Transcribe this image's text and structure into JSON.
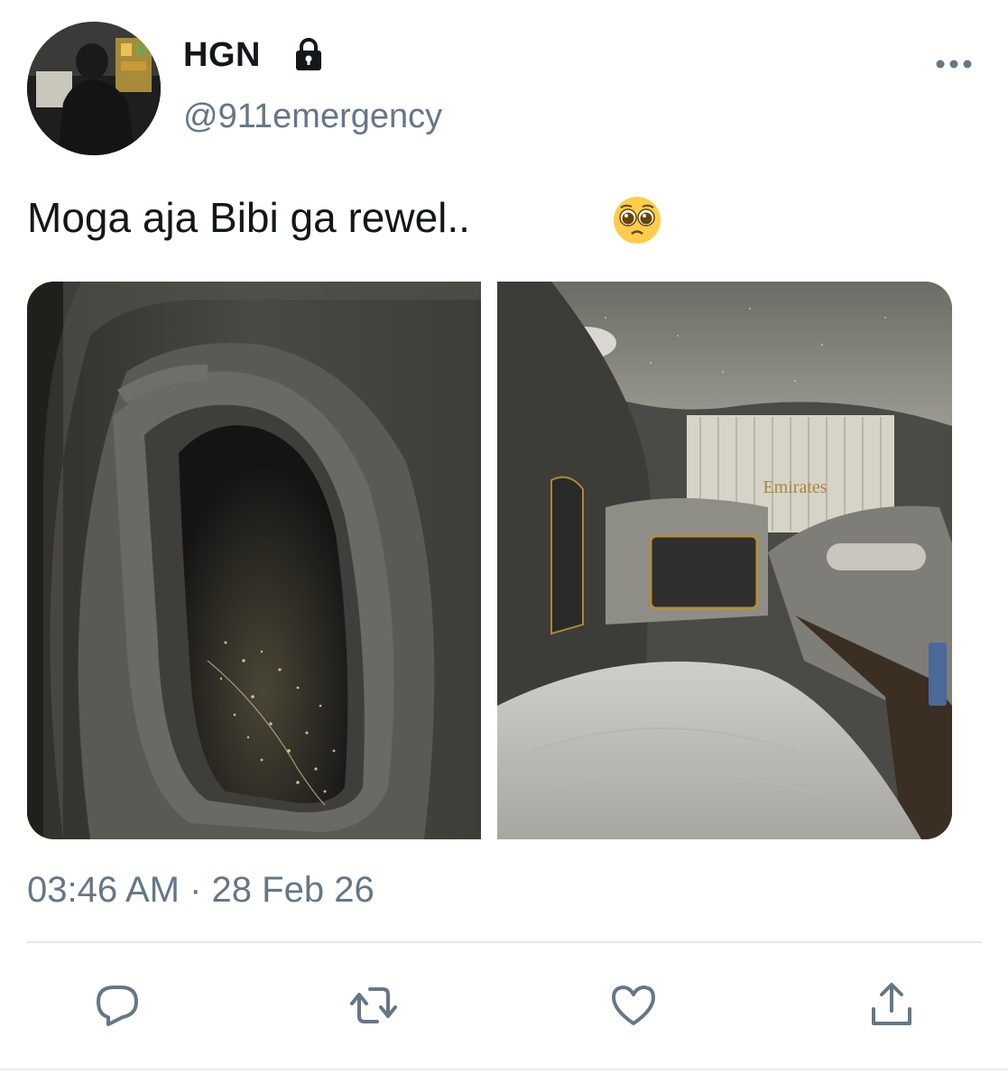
{
  "tweet": {
    "display_name": "HGN",
    "handle": "@911emergency",
    "text": "Moga aja Bibi ga rewel..",
    "emoji": "pleading-face-emoji",
    "timestamp": "03:46 AM · 28 Feb 26",
    "locked_account": true
  },
  "photos": [
    {
      "name": "airplane-window-night-city-photo"
    },
    {
      "name": "emirates-first-class-suite-photo",
      "visible_logo_text": "Emirates"
    }
  ],
  "actions": [
    {
      "name": "reply",
      "icon": "reply-icon"
    },
    {
      "name": "retweet",
      "icon": "retweet-icon"
    },
    {
      "name": "like",
      "icon": "heart-icon"
    },
    {
      "name": "share",
      "icon": "share-icon"
    }
  ],
  "colors": {
    "primary_text": "#14171a",
    "secondary_text": "#657786",
    "divider": "#e1e8ed"
  }
}
